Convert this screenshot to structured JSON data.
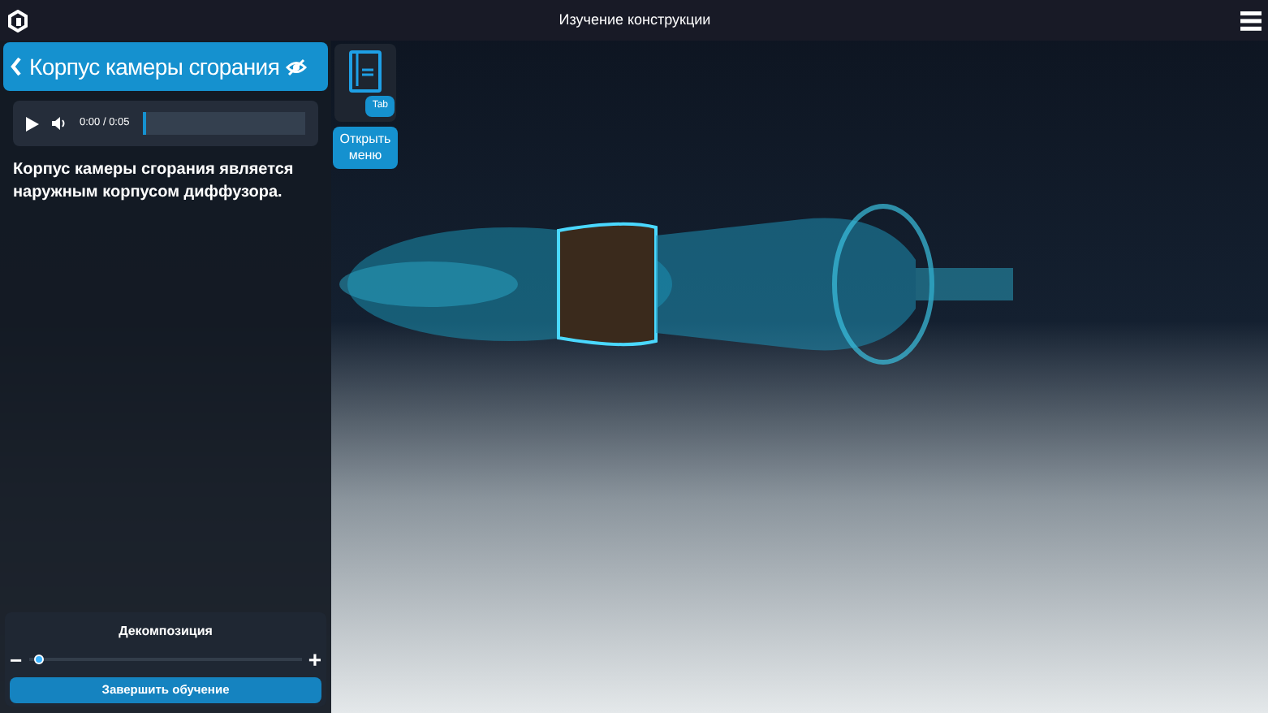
{
  "window": {
    "title": "Изучение конструкции"
  },
  "panel": {
    "title": "Корпус камеры сгорания",
    "audio": {
      "time": "0:00 / 0:05",
      "level": 0
    },
    "description": "Корпус камеры сгорания является наружным корпусом диффузора."
  },
  "menu": {
    "key": "Tab",
    "button": "Открыть меню"
  },
  "decomposition": {
    "title": "Декомпозиция",
    "minus": "−",
    "plus": "+",
    "level": 0.02
  },
  "finish_button": "Завершить обучение"
}
